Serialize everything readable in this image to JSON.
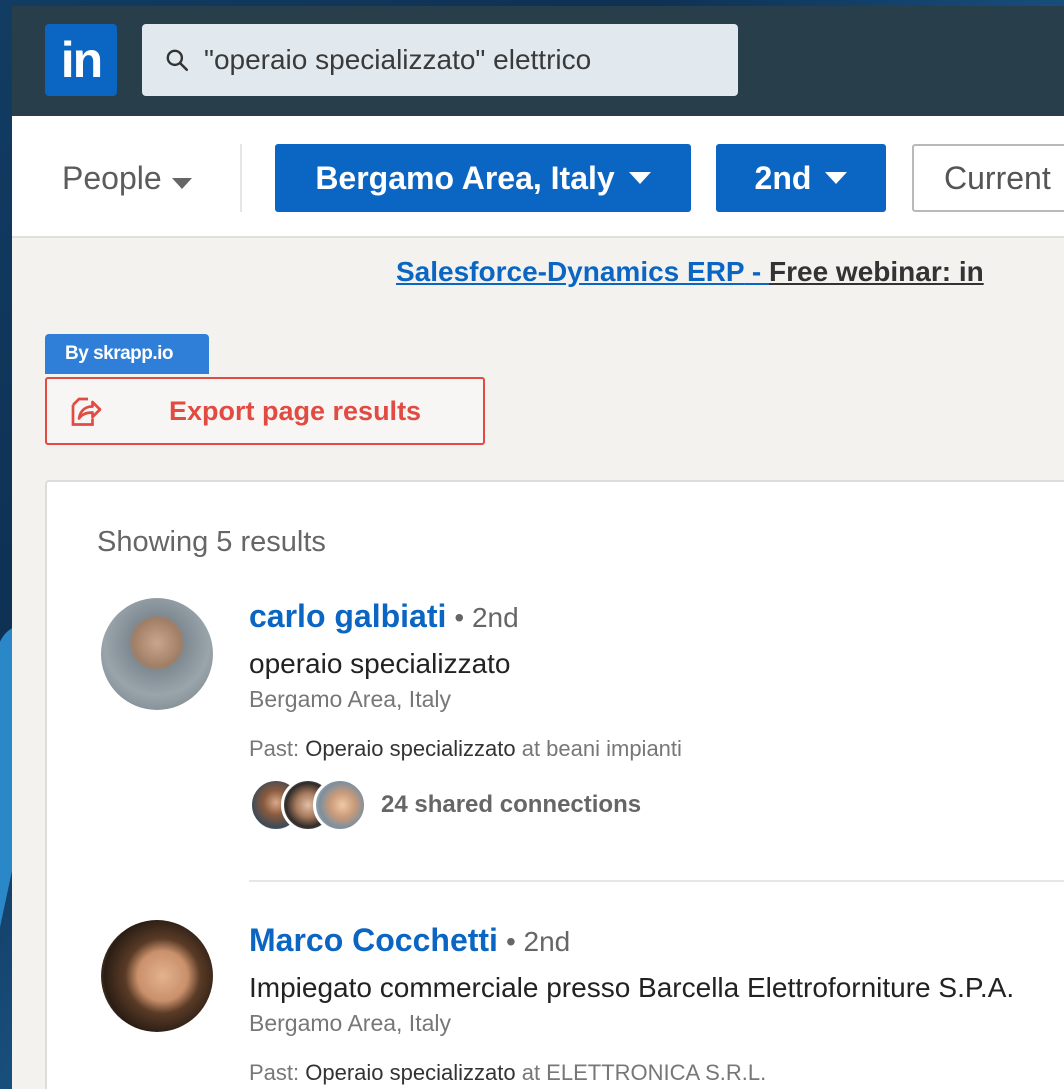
{
  "nav": {
    "logo_text": "in",
    "search_value": "\"operaio specializzato\" elettrico"
  },
  "filters": {
    "type_label": "People",
    "location_label": "Bergamo Area, Italy",
    "connection_label": "2nd",
    "current_label": "Current"
  },
  "ad": {
    "link_text": "Salesforce-Dynamics ERP",
    "separator": " - ",
    "text": "Free webinar: in"
  },
  "skrapp": {
    "tag": "By skrapp.io",
    "export_label": "Export page results"
  },
  "results": {
    "showing": "Showing 5 results",
    "items": [
      {
        "name": "carlo galbiati",
        "degree": "• 2nd",
        "headline": "operaio specializzato",
        "location": "Bergamo Area, Italy",
        "past_prefix": "Past: ",
        "past_position": "Operaio specializzato",
        "past_suffix": " at beani impianti",
        "shared": "24 shared connections"
      },
      {
        "name": "Marco Cocchetti",
        "degree": "• 2nd",
        "headline": "Impiegato commerciale presso Barcella Elettroforniture S.P.A.",
        "location": "Bergamo Area, Italy",
        "past_prefix": "Past: ",
        "past_position": "Operaio specializzato",
        "past_suffix": " at ELETTRONICA S.R.L."
      }
    ]
  },
  "colors": {
    "linkedin_blue": "#0a66c2",
    "nav_bg": "#283e4a",
    "skrapp_red": "#e24b41",
    "skrapp_blue": "#2f7fd8"
  }
}
